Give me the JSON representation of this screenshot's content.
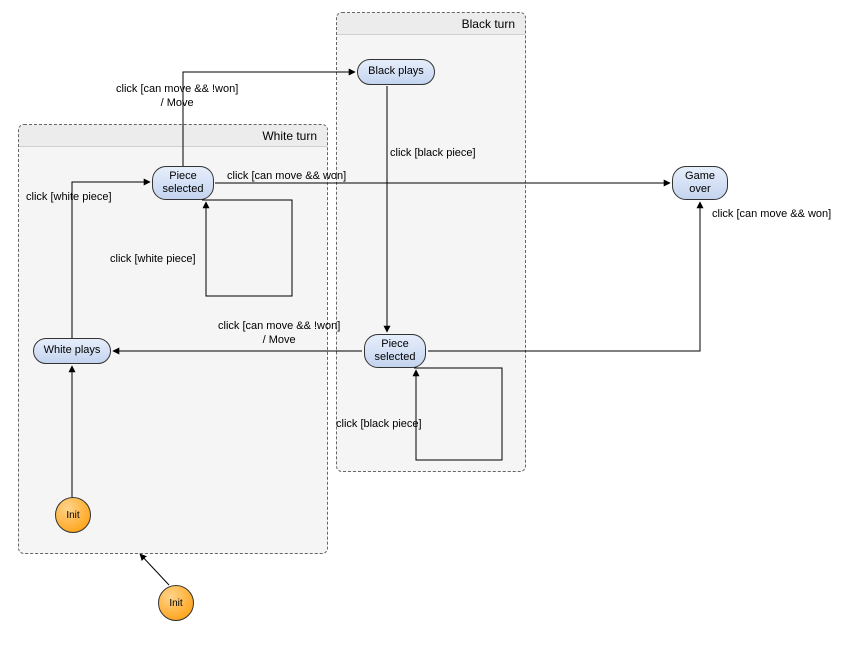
{
  "regions": {
    "white": {
      "title": "White turn"
    },
    "black": {
      "title": "Black turn"
    }
  },
  "states": {
    "white_plays": "White plays",
    "white_piece_selected": "Piece selected",
    "black_plays": "Black plays",
    "black_piece_selected": "Piece selected",
    "game_over": "Game over",
    "init_inner": "Init",
    "init_outer": "Init"
  },
  "edges": {
    "white_to_black_plays": "click [can move && !won]\n/ Move",
    "white_plays_guard": "click [white piece]",
    "white_piece_loop": "click [white piece]",
    "white_to_game_over": "click [can move && won]",
    "black_plays_guard": "click [black piece]",
    "black_piece_loop": "click [black piece]",
    "black_to_white_plays": "click [can move && !won]\n/ Move",
    "black_to_game_over": "click [can move && won]"
  },
  "chart_data": {
    "type": "state-diagram",
    "regions": [
      {
        "id": "white_turn",
        "label": "White turn",
        "states": [
          "white_plays",
          "white_piece_selected",
          "init_inner"
        ]
      },
      {
        "id": "black_turn",
        "label": "Black turn",
        "states": [
          "black_plays",
          "black_piece_selected"
        ]
      }
    ],
    "states": [
      {
        "id": "white_plays",
        "label": "White plays",
        "region": "white_turn"
      },
      {
        "id": "white_piece_selected",
        "label": "Piece selected",
        "region": "white_turn"
      },
      {
        "id": "black_plays",
        "label": "Black plays",
        "region": "black_turn"
      },
      {
        "id": "black_piece_selected",
        "label": "Piece selected",
        "region": "black_turn"
      },
      {
        "id": "game_over",
        "label": "Game over",
        "region": null
      },
      {
        "id": "init_inner",
        "label": "Init",
        "initial": true,
        "region": "white_turn"
      },
      {
        "id": "init_outer",
        "label": "Init",
        "initial": true,
        "region": null
      }
    ],
    "transitions": [
      {
        "from": "init_outer",
        "to": "white_turn",
        "label": ""
      },
      {
        "from": "init_inner",
        "to": "white_plays",
        "label": ""
      },
      {
        "from": "white_plays",
        "to": "white_piece_selected",
        "label": "click [white piece]"
      },
      {
        "from": "white_piece_selected",
        "to": "white_piece_selected",
        "label": "click [white piece]"
      },
      {
        "from": "white_piece_selected",
        "to": "black_plays",
        "label": "click [can move && !won] / Move"
      },
      {
        "from": "white_piece_selected",
        "to": "game_over",
        "label": "click [can move && won]"
      },
      {
        "from": "black_plays",
        "to": "black_piece_selected",
        "label": "click [black piece]"
      },
      {
        "from": "black_piece_selected",
        "to": "black_piece_selected",
        "label": "click [black piece]"
      },
      {
        "from": "black_piece_selected",
        "to": "white_plays",
        "label": "click [can move && !won] / Move"
      },
      {
        "from": "black_piece_selected",
        "to": "game_over",
        "label": "click [can move && won]"
      }
    ]
  }
}
